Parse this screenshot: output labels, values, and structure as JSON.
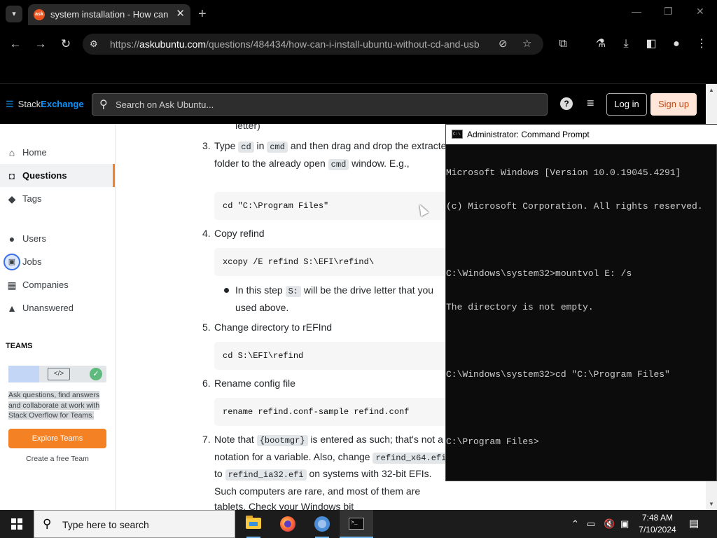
{
  "browser": {
    "tab_title": "system installation - How can I",
    "favicon_text": "ask",
    "url_prefix": "https://",
    "url_host": "askubuntu.com",
    "url_path": "/questions/484434/how-can-i-install-ubuntu-without-cd-and-usb"
  },
  "se_bar": {
    "logo_part1": "Stack",
    "logo_part2": "Exchange",
    "search_placeholder": "Search on Ask Ubuntu...",
    "login": "Log in",
    "signup": "Sign up"
  },
  "sidebar": {
    "items": [
      {
        "label": "Home",
        "icon": "home-icon"
      },
      {
        "label": "Questions",
        "icon": "questions-icon"
      },
      {
        "label": "Tags",
        "icon": "tag-icon"
      },
      {
        "label": "Users",
        "icon": "users-icon"
      },
      {
        "label": "Jobs",
        "icon": "briefcase-icon"
      },
      {
        "label": "Companies",
        "icon": "building-icon"
      },
      {
        "label": "Unanswered",
        "icon": "unanswered-icon"
      }
    ],
    "teams_heading": "TEAMS",
    "teams_text": "Ask questions, find answers and collaborate at work with Stack Overflow for Teams.",
    "teams_button": "Explore Teams",
    "teams_free": "Create a free Team"
  },
  "content": {
    "prev_tail": "letter)",
    "step3_num": "3.",
    "step3_a": "Type ",
    "step3_code1": "cd",
    "step3_b": " in ",
    "step3_code2": "cmd",
    "step3_c": " and then drag and drop the extracted folder to the already open ",
    "step3_code3": "cmd",
    "step3_d": " window. E.g.,",
    "code1": "cd \"C:\\Program Files\"",
    "step4_num": "4.",
    "step4": "Copy refind",
    "code2": "xcopy /E refind S:\\EFI\\refind\\",
    "bullet_a": "In this step ",
    "bullet_code": "S:",
    "bullet_b": " will be the drive letter that you used above.",
    "step5_num": "5.",
    "step5": "Change directory to rEFInd",
    "code3": "cd S:\\EFI\\refind",
    "step6_num": "6.",
    "step6": "Rename config file",
    "code4": "rename refind.conf-sample refind.conf",
    "step7_num": "7.",
    "step7_a": "Note that ",
    "step7_code1": "{bootmgr}",
    "step7_b": " is entered as such; that's not a notation for a variable. Also, change ",
    "step7_code2": "refind_x64.efi",
    "step7_c": " to ",
    "step7_code3": "refind_ia32.efi",
    "step7_d": " on systems with 32-bit EFIs. Such computers are rare, and most of them are tablets. Check your Windows bit"
  },
  "cmd": {
    "title": "Administrator: Command Prompt",
    "lines": [
      "Microsoft Windows [Version 10.0.19045.4291]",
      "(c) Microsoft Corporation. All rights reserved.",
      "",
      "C:\\Windows\\system32>mountvol E: /s",
      "The directory is not empty.",
      "",
      "C:\\Windows\\system32>cd \"C:\\Program Files\"",
      "",
      "C:\\Program Files>"
    ]
  },
  "taskbar": {
    "search_placeholder": "Type here to search",
    "time": "7:48 AM",
    "date": "7/10/2024"
  },
  "colors": {
    "accent_orange": "#f48225",
    "se_blue": "#0a95ff",
    "cmd_bg": "#0c0c0c"
  }
}
